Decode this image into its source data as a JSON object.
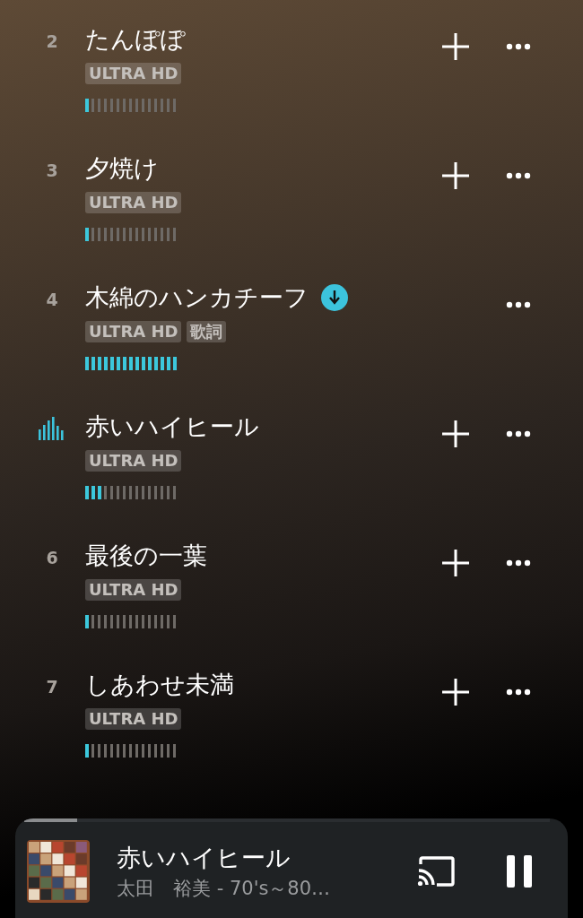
{
  "tracks": [
    {
      "number": "2",
      "title": "たんぽぽ",
      "badges": [
        "ULTRA HD"
      ],
      "level": 0.067,
      "playing": false,
      "downloaded": false,
      "addable": true
    },
    {
      "number": "3",
      "title": "夕焼け",
      "badges": [
        "ULTRA HD"
      ],
      "level": 0.067,
      "playing": false,
      "downloaded": false,
      "addable": true
    },
    {
      "number": "4",
      "title": "木綿のハンカチーフ",
      "badges": [
        "ULTRA HD",
        "歌詞"
      ],
      "level": 1,
      "playing": false,
      "downloaded": true,
      "addable": false
    },
    {
      "title": "赤いハイヒール",
      "badges": [
        "ULTRA HD"
      ],
      "level": 0.2,
      "playing": true,
      "downloaded": false,
      "addable": true
    },
    {
      "number": "6",
      "title": "最後の一葉",
      "badges": [
        "ULTRA HD"
      ],
      "level": 0.067,
      "playing": false,
      "downloaded": false,
      "addable": true
    },
    {
      "number": "7",
      "title": "しあわせ未満",
      "badges": [
        "ULTRA HD"
      ],
      "level": 0.067,
      "playing": false,
      "downloaded": false,
      "addable": true
    }
  ],
  "player": {
    "title": "赤いハイヒール",
    "subtitle": "太田　裕美 - 70's～80…",
    "level": 0.1,
    "playing": true
  }
}
